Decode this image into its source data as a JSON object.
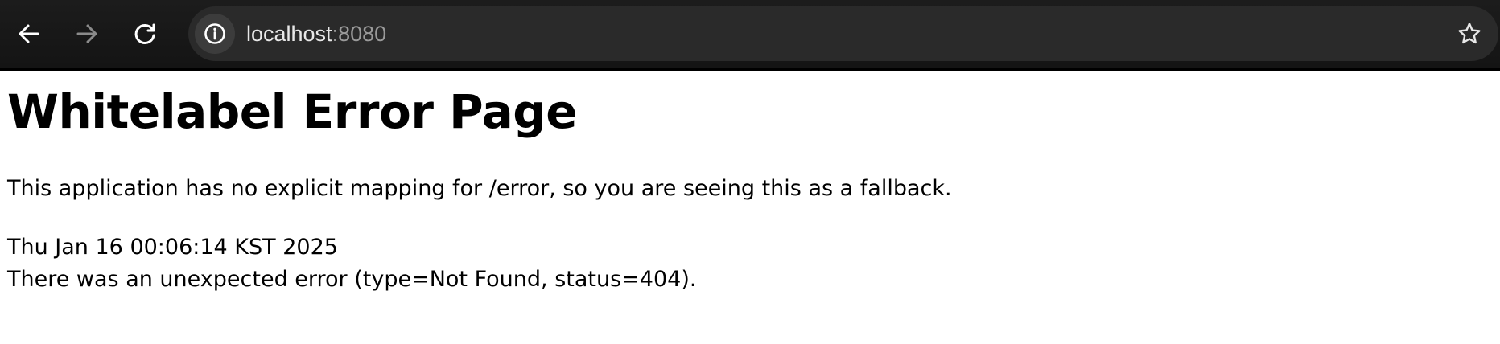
{
  "browser": {
    "icons": {
      "back": "arrow-left-icon",
      "forward": "arrow-right-icon",
      "reload": "reload-icon",
      "site_info": "info-icon",
      "bookmark": "star-icon"
    },
    "address_bar": {
      "host": "localhost",
      "port": ":8080"
    },
    "colors": {
      "toolbar": "#1c1c1c",
      "omnibox": "#2a2a2a",
      "icon_active": "#ffffff",
      "icon_disabled": "#8a8a8a"
    }
  },
  "page": {
    "title": "Whitelabel Error Page",
    "message": "This application has no explicit mapping for /error, so you are seeing this as a fallback.",
    "timestamp": "Thu Jan 16 00:06:14 KST 2025",
    "error_detail": "There was an unexpected error (type=Not Found, status=404)."
  }
}
